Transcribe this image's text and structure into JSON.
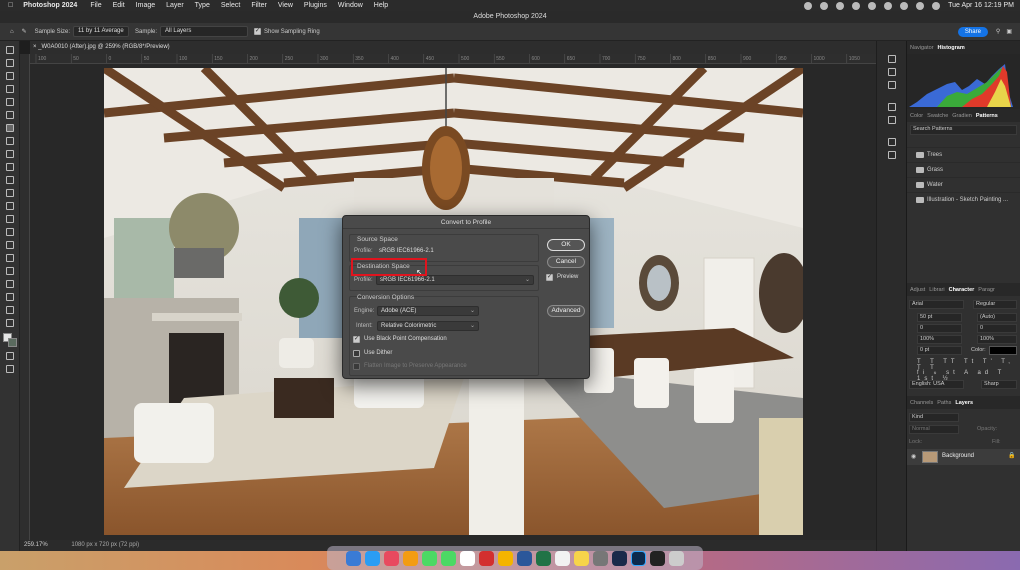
{
  "menubar": {
    "app": "Photoshop 2024",
    "items": [
      "File",
      "Edit",
      "Image",
      "Layer",
      "Type",
      "Select",
      "Filter",
      "View",
      "Plugins",
      "Window",
      "Help"
    ],
    "clock": "Tue Apr 16  12:19 PM"
  },
  "window": {
    "title": "Adobe Photoshop 2024"
  },
  "options": {
    "sample_size_label": "Sample Size:",
    "sample_size_value": "11 by 11 Average",
    "sample_label": "Sample:",
    "sample_value": "All Layers",
    "sampling_ring_label": "Show Sampling Ring",
    "share_label": "Share"
  },
  "document": {
    "tab_title": "_W0A0010 (After).jpg @ 259% (RGB/8*/Preview)",
    "zoom": "259.17%",
    "dimensions": "1080 px x 720 px (72 ppi)"
  },
  "ruler_ticks": [
    "100",
    "50",
    "0",
    "50",
    "100",
    "150",
    "200",
    "250",
    "300",
    "350",
    "400",
    "450",
    "500",
    "550",
    "600",
    "650",
    "700",
    "750",
    "800",
    "850",
    "900",
    "950",
    "1000",
    "1050"
  ],
  "dialog": {
    "title": "Convert to Profile",
    "source_space_label": "Source Space",
    "source_profile_label": "Profile:",
    "source_profile_value": "sRGB IEC61966-2.1",
    "destination_space_label": "Destination Space",
    "destination_profile_label": "Profile:",
    "destination_profile_value": "sRGB IEC61966-2.1",
    "conversion_options_label": "Conversion Options",
    "engine_label": "Engine:",
    "engine_value": "Adobe (ACE)",
    "intent_label": "Intent:",
    "intent_value": "Relative Colorimetric",
    "black_point_label": "Use Black Point Compensation",
    "black_point_checked": true,
    "dither_label": "Use Dither",
    "dither_checked": false,
    "flatten_label": "Flatten Image to Preserve Appearance",
    "ok_label": "OK",
    "cancel_label": "Cancel",
    "preview_label": "Preview",
    "preview_checked": true,
    "advanced_label": "Advanced"
  },
  "panels": {
    "top_tabs": [
      "Navigator",
      "Histogram"
    ],
    "top_active": "Histogram",
    "mid_tabs": [
      "Color",
      "Swatche",
      "Gradien",
      "Patterns"
    ],
    "mid_active": "Patterns",
    "search_placeholder": "Search Patterns",
    "pattern_groups": [
      "Trees",
      "Grass",
      "Water",
      "Illustration - Sketch Painting ..."
    ],
    "char_tabs": [
      "Adjust",
      "Librari",
      "Character",
      "Paragr"
    ],
    "char_active": "Character",
    "font_family": "Arial",
    "font_style": "Regular",
    "font_size": "50 pt",
    "leading": "(Auto)",
    "kerning": "0",
    "tracking": "0",
    "vscale": "100%",
    "hscale": "100%",
    "baseline": "0 pt",
    "color_label": "Color:",
    "language": "English: USA",
    "antialias": "Sharp",
    "layer_tabs": [
      "Channels",
      "Paths",
      "Layers"
    ],
    "layer_active": "Layers",
    "kind_label": "Kind",
    "blend_mode": "Normal",
    "opacity_label": "Opacity:",
    "lock_label": "Lock:",
    "fill_label": "Fill:",
    "layer_name": "Background"
  }
}
